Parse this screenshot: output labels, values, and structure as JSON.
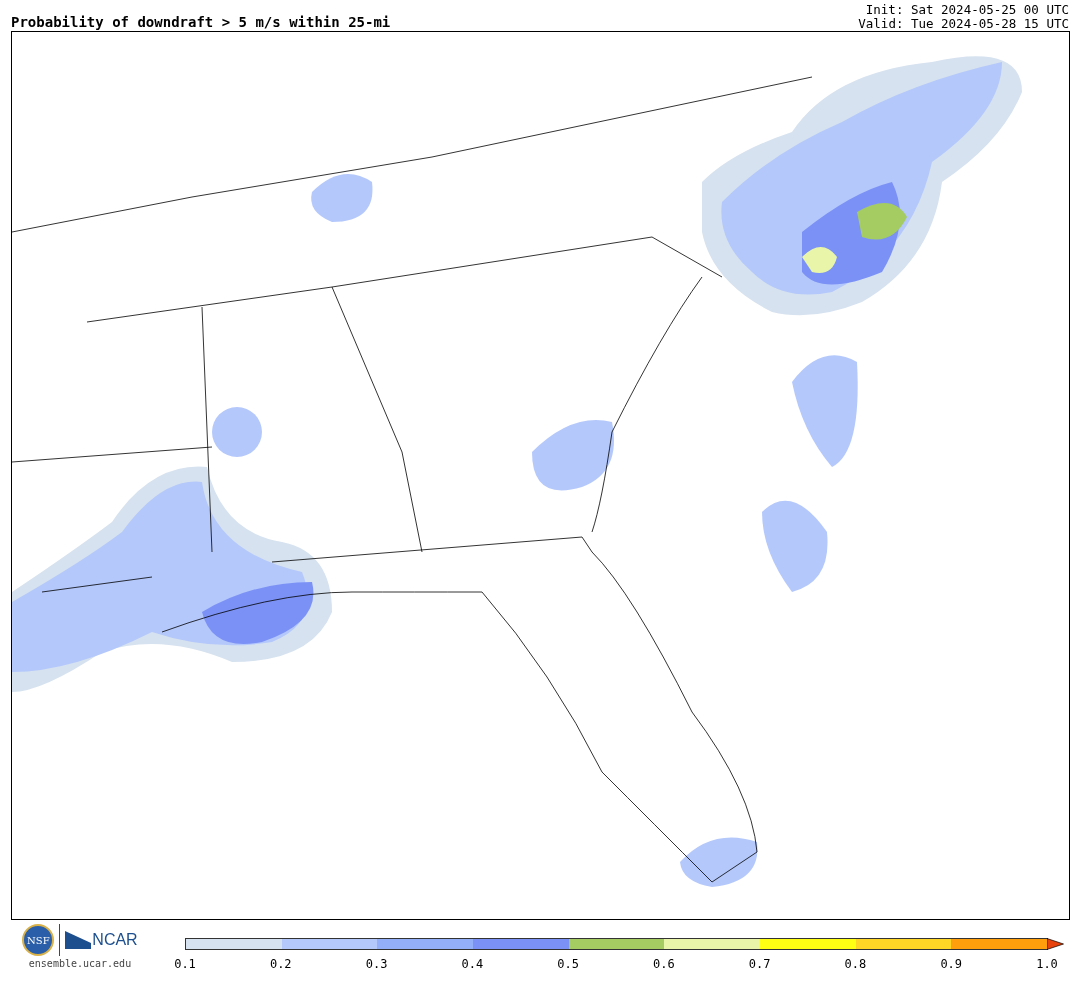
{
  "title": "Probability of downdraft > 5 m/s within 25-mi",
  "init": "Init: Sat 2024-05-25 00 UTC",
  "valid": "Valid: Tue 2024-05-28 15 UTC",
  "logos": {
    "nsf": "NSF",
    "ncar": "NCAR",
    "url": "ensemble.ucar.edu"
  },
  "colorbar": {
    "bins": [
      {
        "color": "#d6e2ef"
      },
      {
        "color": "#b4c8fb"
      },
      {
        "color": "#93affa"
      },
      {
        "color": "#7b91f6"
      },
      {
        "color": "#a4cc63"
      },
      {
        "color": "#e9f6a9"
      },
      {
        "color": "#ffff14"
      },
      {
        "color": "#ffd526"
      },
      {
        "color": "#ff9f0c"
      }
    ],
    "extend": {
      "color": "#e8420c"
    },
    "ticks": [
      "0.1",
      "0.2",
      "0.3",
      "0.4",
      "0.5",
      "0.6",
      "0.7",
      "0.8",
      "0.9",
      "1.0"
    ]
  }
}
